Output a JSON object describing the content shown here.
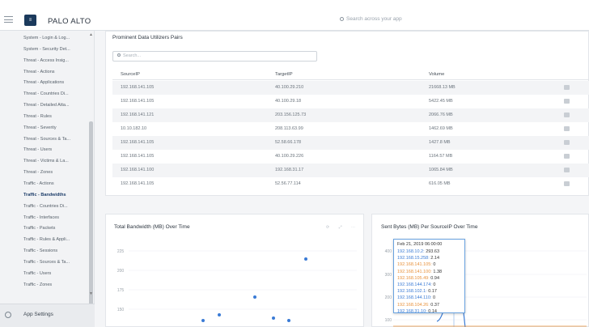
{
  "header": {
    "brand": "PALO ALTO",
    "search_placeholder": "Search across your app"
  },
  "sidebar": {
    "items": [
      {
        "label": "System - Login & Log...",
        "active": false
      },
      {
        "label": "System - Security Det...",
        "active": false
      },
      {
        "label": "Threat - Access Insig...",
        "active": false
      },
      {
        "label": "Threat - Actions",
        "active": false
      },
      {
        "label": "Threat - Applications",
        "active": false
      },
      {
        "label": "Threat - Countries Di...",
        "active": false
      },
      {
        "label": "Threat - Detailed Atta...",
        "active": false
      },
      {
        "label": "Threat - Rules",
        "active": false
      },
      {
        "label": "Threat - Severity",
        "active": false
      },
      {
        "label": "Threat - Sources & Ta...",
        "active": false
      },
      {
        "label": "Threat - Users",
        "active": false
      },
      {
        "label": "Threat - Victims & La...",
        "active": false
      },
      {
        "label": "Threat - Zones",
        "active": false
      },
      {
        "label": "Traffic - Actions",
        "active": false
      },
      {
        "label": "Traffic - Bandwidths",
        "active": true
      },
      {
        "label": "Traffic - Countries Di...",
        "active": false
      },
      {
        "label": "Traffic - Interfaces",
        "active": false
      },
      {
        "label": "Traffic - Packets",
        "active": false
      },
      {
        "label": "Traffic - Rules & Appli...",
        "active": false
      },
      {
        "label": "Traffic - Sessions",
        "active": false
      },
      {
        "label": "Traffic - Sources & Ta...",
        "active": false
      },
      {
        "label": "Traffic - Users",
        "active": false
      },
      {
        "label": "Traffic - Zones",
        "active": false
      }
    ],
    "settings_label": "App Settings"
  },
  "pairs_panel": {
    "title": "Prominent Data Utilizers Pairs",
    "search_placeholder": "Search...",
    "columns": [
      "SourceIP",
      "TargetIP",
      "Volume"
    ],
    "rows": [
      [
        "192.168.141.105",
        "40.100.29.210",
        "21668.13 MB"
      ],
      [
        "192.168.141.105",
        "40.100.29.18",
        "5422.45 MB"
      ],
      [
        "192.168.141.121",
        "203.156.125.73",
        "2066.76 MB"
      ],
      [
        "10.10.182.10",
        "208.113.63.99",
        "1462.69 MB"
      ],
      [
        "192.168.141.105",
        "52.58.66.178",
        "1427.8 MB"
      ],
      [
        "192.168.141.105",
        "40.100.29.226",
        "1164.57 MB"
      ],
      [
        "192.168.141.100",
        "192.168.31.17",
        "1065.84 MB"
      ],
      [
        "192.168.141.105",
        "52.56.77.114",
        "616.05 MB"
      ]
    ]
  },
  "bandwidth_panel": {
    "title": "Total Bandwidth (MB) Over Time",
    "tools": "⟳ ⤢ ⋯",
    "y_ticks": [
      "225",
      "200",
      "175",
      "150"
    ]
  },
  "sent_panel": {
    "title": "Sent Bytes (MB) Per SourceIP Over Time",
    "y_ticks": [
      "400",
      "300",
      "200",
      "100"
    ]
  },
  "tooltip": {
    "date": "Feb 21, 2019 06:00:00",
    "rows": [
      {
        "ip": "192.168.10.2:",
        "value": "293.63",
        "color": "blue"
      },
      {
        "ip": "192.168.15.258:",
        "value": "2.14",
        "color": "blue"
      },
      {
        "ip": "192.168.141.105:",
        "value": "0",
        "color": "orange"
      },
      {
        "ip": "192.168.141.100:",
        "value": "1.38",
        "color": "orange"
      },
      {
        "ip": "192.168.105.49:",
        "value": "0.94",
        "color": "orange"
      },
      {
        "ip": "192.168.144.174:",
        "value": "0",
        "color": "blue"
      },
      {
        "ip": "192.168.102.1:",
        "value": "0.17",
        "color": "blue"
      },
      {
        "ip": "192.168.144.110:",
        "value": "0",
        "color": "blue"
      },
      {
        "ip": "192.168.104.26:",
        "value": "0.37",
        "color": "orange"
      },
      {
        "ip": "192.168.31.10:",
        "value": "0.14",
        "color": "blue"
      }
    ]
  },
  "colors": {
    "accent": "#1f3f6b",
    "series_blue": "#3a7bd5",
    "series_orange": "#e8913a"
  }
}
